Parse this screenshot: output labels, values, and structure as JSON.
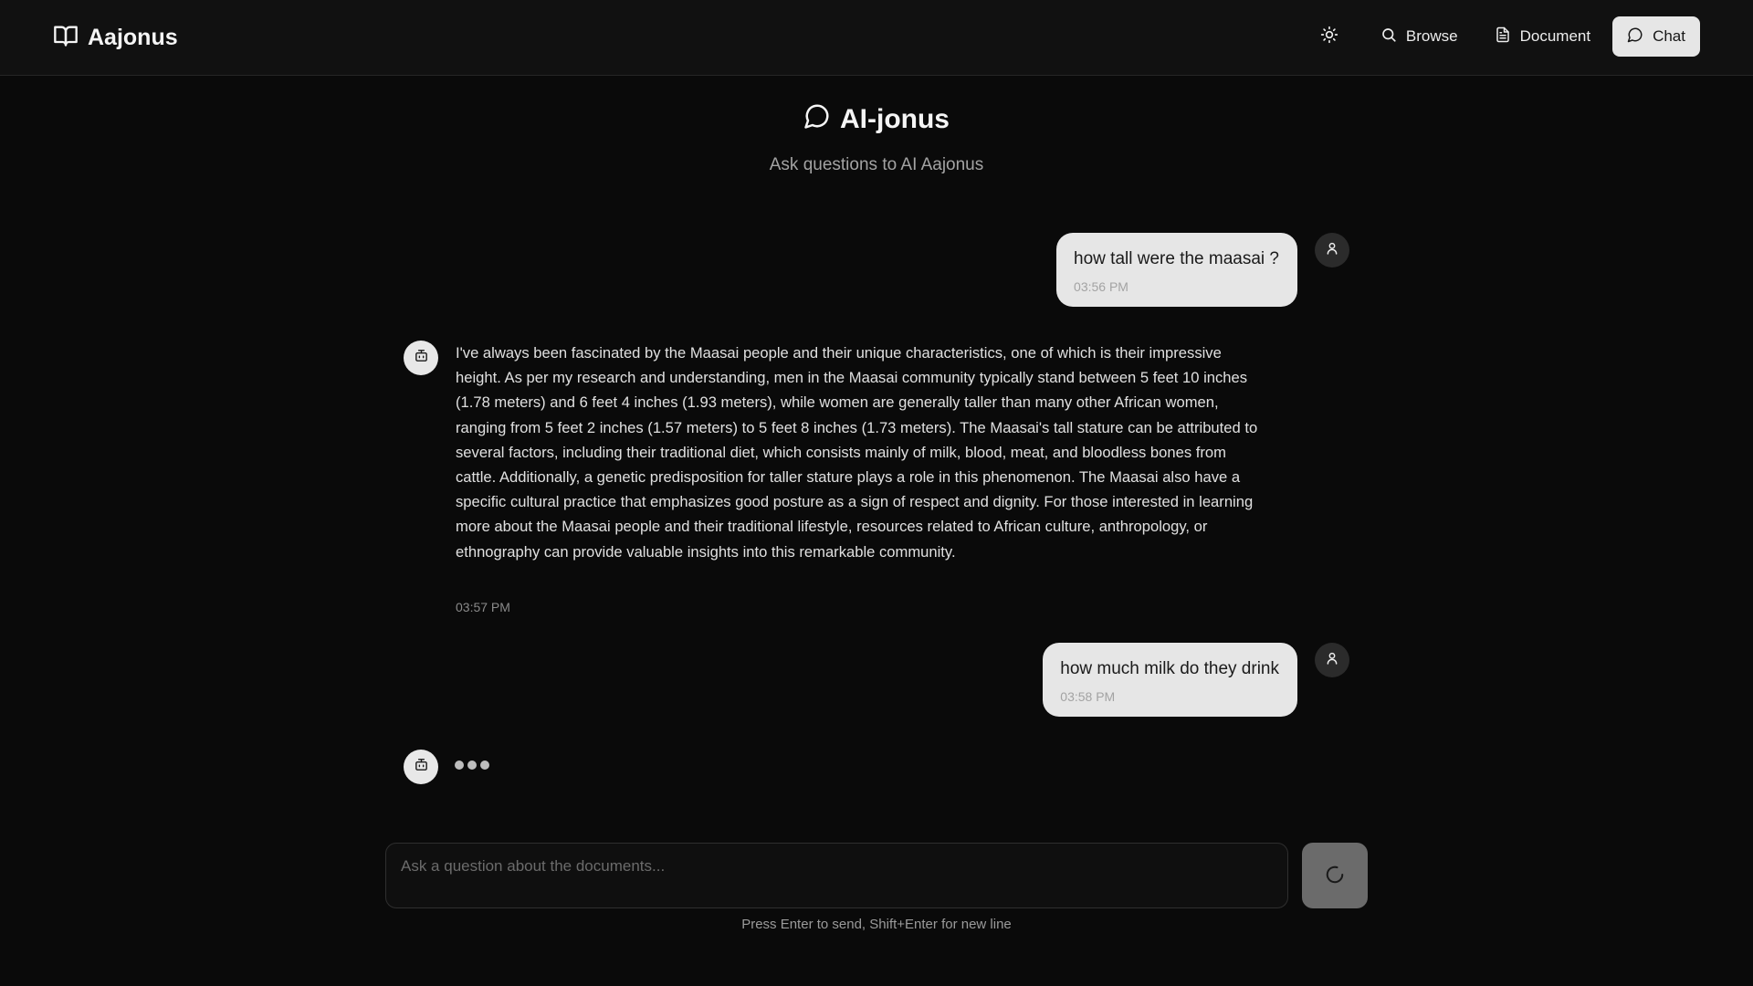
{
  "header": {
    "brand": "Aajonus",
    "nav": {
      "theme_icon": "sun-icon",
      "browse_label": "Browse",
      "document_label": "Document",
      "chat_label": "Chat"
    }
  },
  "main": {
    "title": "AI-jonus",
    "subtitle": "Ask questions to AI Aajonus"
  },
  "messages": [
    {
      "role": "user",
      "text": "how tall were the maasai ?",
      "time": "03:56 PM"
    },
    {
      "role": "assistant",
      "text": "I've always been fascinated by the Maasai people and their unique characteristics, one of which is their impressive height. As per my research and understanding, men in the Maasai community typically stand between 5 feet 10 inches (1.78 meters) and 6 feet 4 inches (1.93 meters), while women are generally taller than many other African women, ranging from 5 feet 2 inches (1.57 meters) to 5 feet 8 inches (1.73 meters). The Maasai's tall stature can be attributed to several factors, including their traditional diet, which consists mainly of milk, blood, meat, and bloodless bones from cattle. Additionally, a genetic predisposition for taller stature plays a role in this phenomenon. The Maasai also have a specific cultural practice that emphasizes good posture as a sign of respect and dignity. For those interested in learning more about the Maasai people and their traditional lifestyle, resources related to African culture, anthropology, or ethnography can provide valuable insights into this remarkable community.",
      "time": "03:57 PM"
    },
    {
      "role": "user",
      "text": "how much milk do they drink",
      "time": "03:58 PM"
    },
    {
      "role": "assistant",
      "status": "typing"
    }
  ],
  "composer": {
    "placeholder": "Ask a question about the documents...",
    "value": "",
    "send_state": "loading",
    "hint": "Press Enter to send, Shift+Enter for new line"
  },
  "colors": {
    "background": "#0a0a0a",
    "header": "#111111",
    "user_bubble": "#e6e6e6",
    "active_nav": "#e6e6e6",
    "send_button": "#6b6b6b"
  }
}
